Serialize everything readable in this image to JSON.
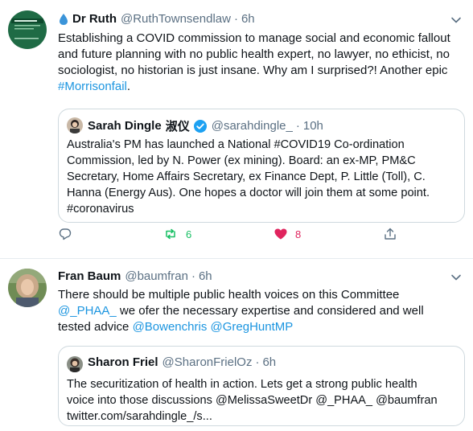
{
  "tweet1": {
    "name": "Dr Ruth",
    "handle": "@RuthTownsendlaw",
    "time": "6h",
    "text_line1": "Establishing a COVID commission to manage social and economic fallout",
    "text_line2": "and future planning with no public health expert, no lawyer, no ethicist, no",
    "text_line3": "sociologist, no historian is just insane. Why am I surprised?! Another epic",
    "hashtag": "#Morrisonfail",
    "hashtag_suffix": ".",
    "quote": {
      "name": "Sarah Dingle",
      "name_suffix": "淑仪",
      "handle": "@sarahdingle_",
      "time": "10h",
      "line1": "Australia's PM has launched a National #COVID19 Co-ordination",
      "line2": "Commission, led by N. Power (ex mining). Board: an ex-MP, PM&C",
      "line3": "Secretary, Home Affairs Secretary, ex Finance Dept, P. Little (Toll), C.",
      "line4": "Hanna (Energy Aus). One hopes a doctor will join them at some point.",
      "line5": "#coronavirus"
    },
    "retweets": "6",
    "likes": "8"
  },
  "tweet2": {
    "name": "Fran Baum",
    "handle": "@baumfran",
    "time": "6h",
    "line1": "There should be multiple public health voices on this Committee",
    "mention1": "@_PHAA_",
    "line2_rest": " we ofer the necessary expertise and considered and well",
    "line3_start": "tested advice ",
    "mention2": "@Bowenchris",
    "mention3": "@GregHuntMP",
    "quote": {
      "name": "Sharon Friel",
      "handle": "@SharonFrielOz",
      "time": "6h",
      "line1": "The securitization of health in action. Lets get a strong public health",
      "line2": "voice into those discussions @MelissaSweetDr @_PHAA_ @baumfran",
      "line3": "twitter.com/sarahdingle_/s..."
    }
  },
  "colors": {
    "link": "#1b95e0",
    "retweet": "#17bf63",
    "like": "#e0245e",
    "verified": "#1da1f2",
    "muted": "#5b7083"
  },
  "icons": [
    "droplet-icon",
    "chevron-down-icon",
    "verified-icon",
    "reply-icon",
    "retweet-icon",
    "like-icon",
    "share-icon"
  ]
}
